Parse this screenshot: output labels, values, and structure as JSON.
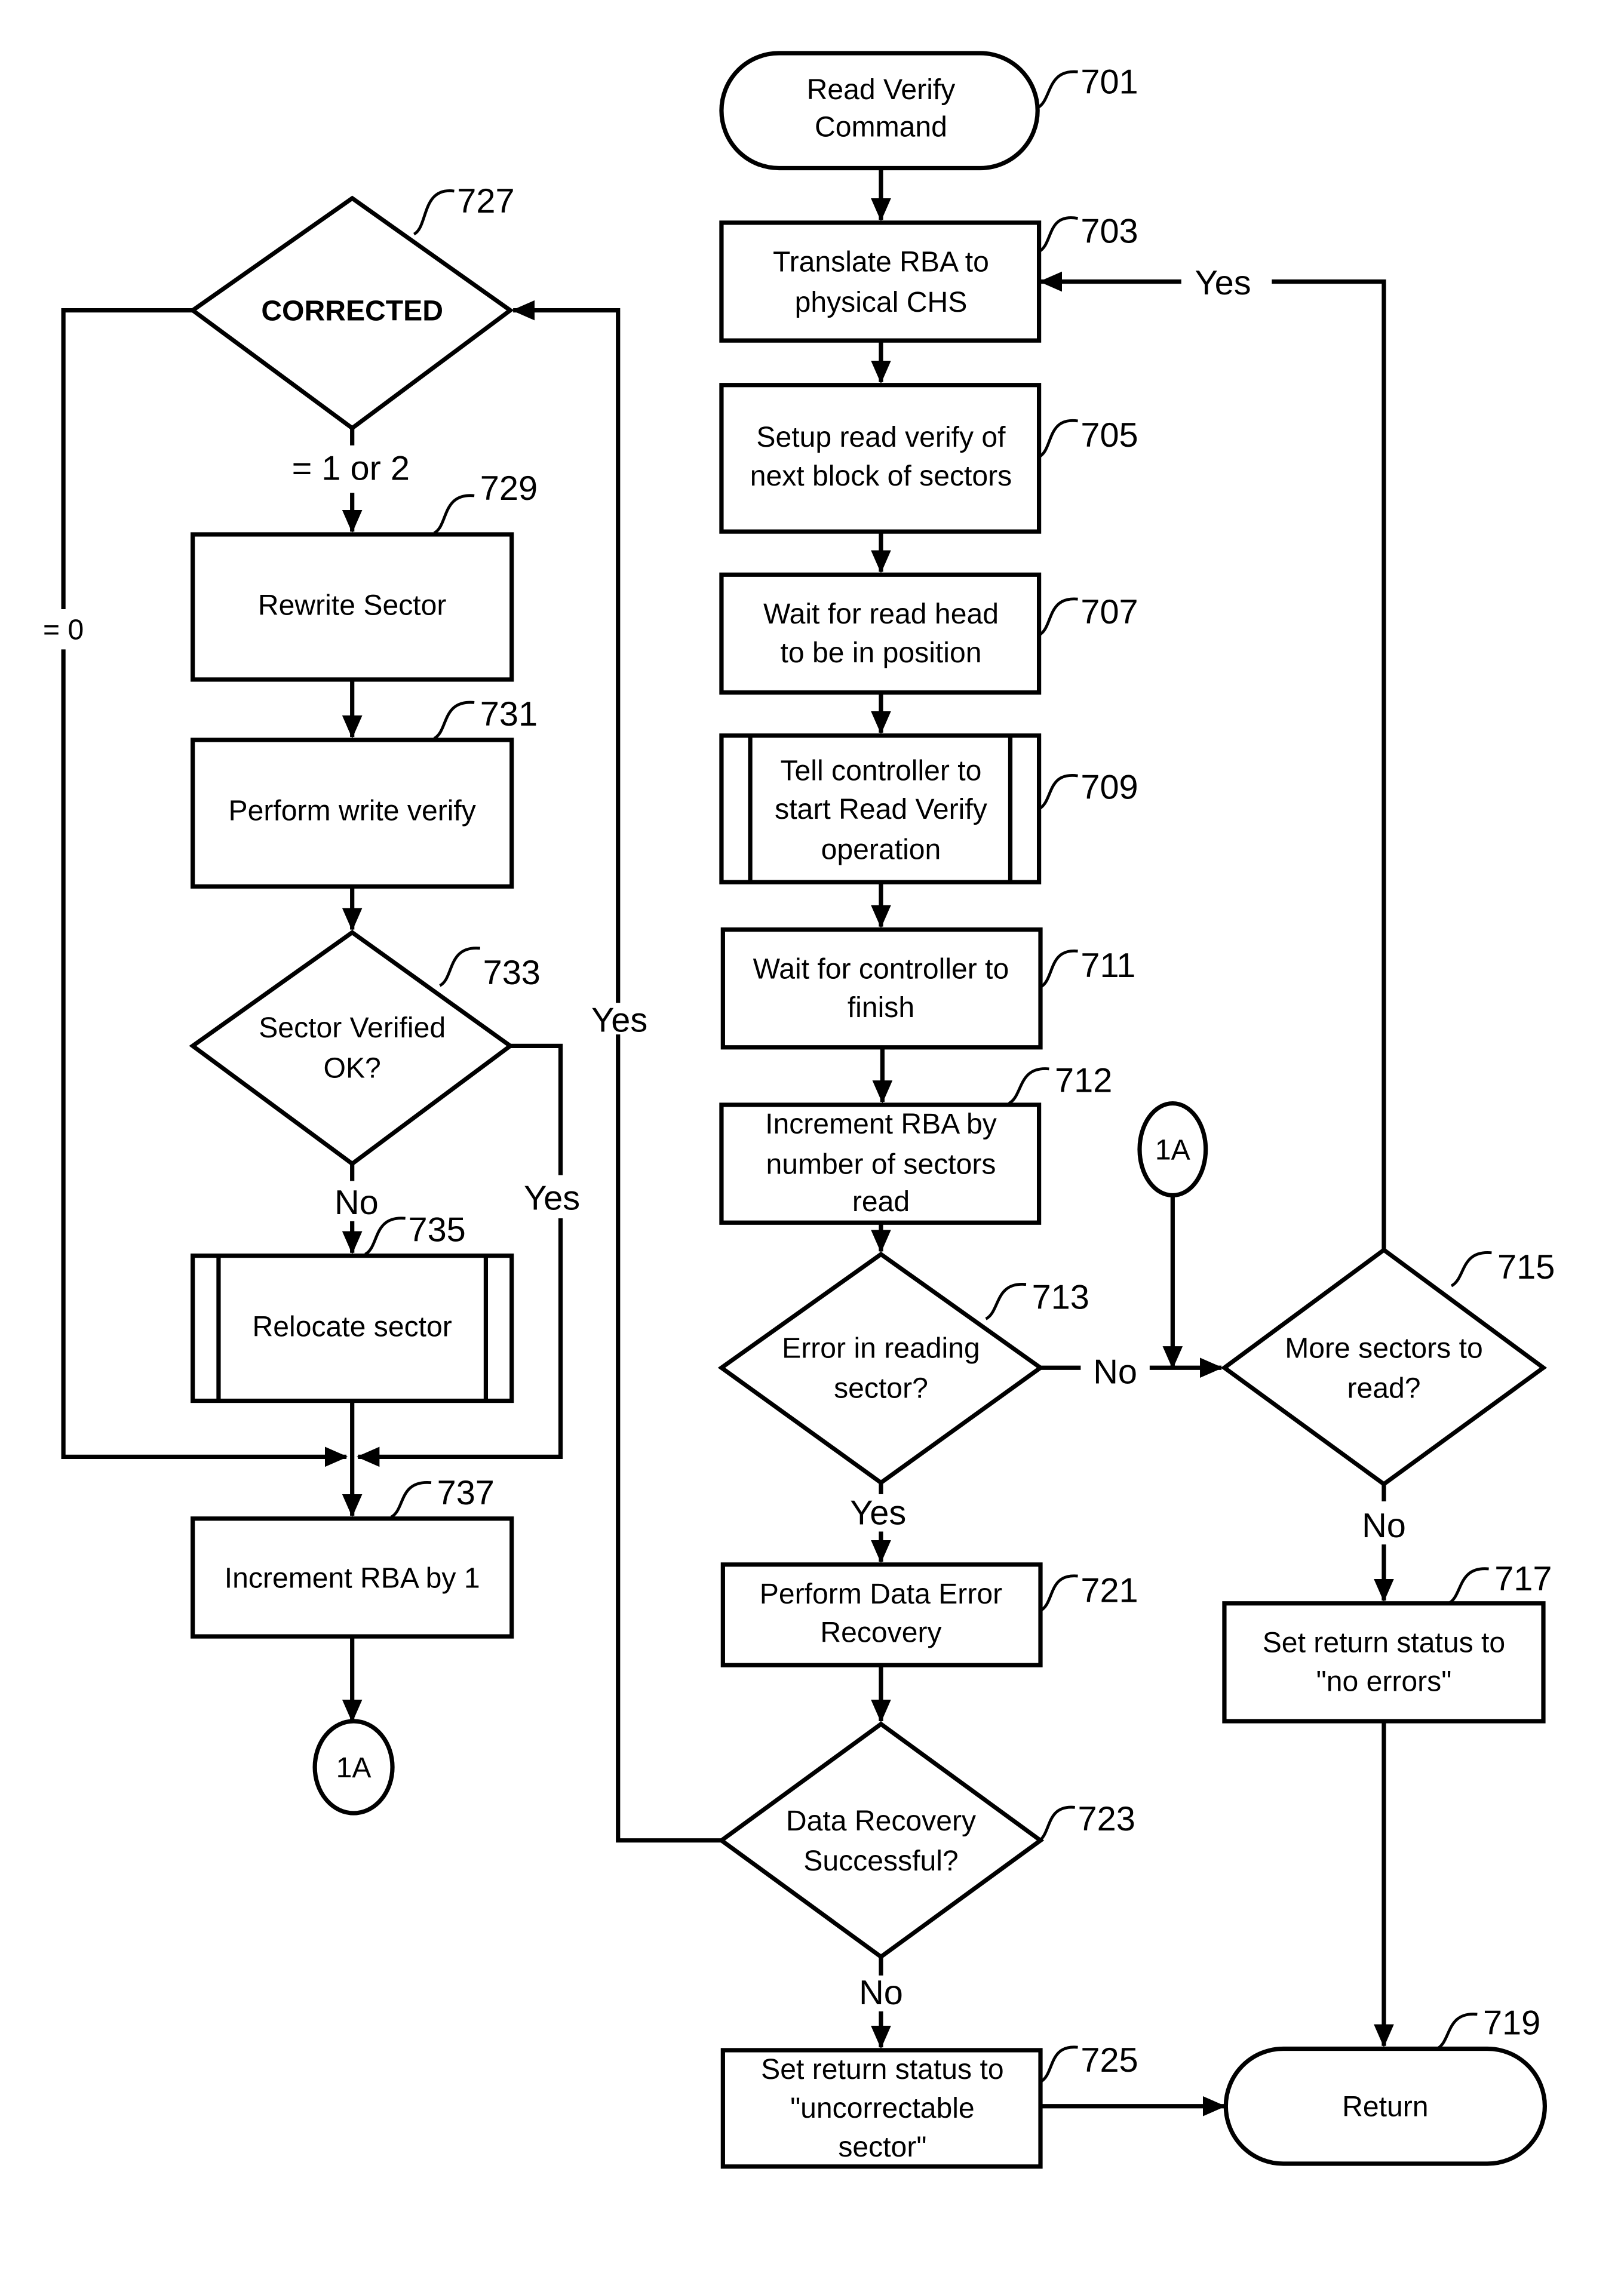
{
  "nodes": {
    "n701": {
      "ref": "701",
      "lines": [
        "Read Verify",
        "Command"
      ]
    },
    "n703": {
      "ref": "703",
      "lines": [
        "Translate RBA to",
        "physical CHS"
      ]
    },
    "n705": {
      "ref": "705",
      "lines": [
        "Setup read verify of",
        "next block of sectors"
      ]
    },
    "n707": {
      "ref": "707",
      "lines": [
        "Wait for read head",
        "to be in position"
      ]
    },
    "n709": {
      "ref": "709",
      "lines": [
        "Tell controller to",
        "start Read Verify",
        "operation"
      ]
    },
    "n711": {
      "ref": "711",
      "lines": [
        "Wait for controller to",
        "finish"
      ]
    },
    "n712": {
      "ref": "712",
      "lines": [
        "Increment RBA by",
        "number of sectors",
        "read"
      ]
    },
    "n713": {
      "ref": "713",
      "lines": [
        "Error in reading",
        "sector?"
      ]
    },
    "n715": {
      "ref": "715",
      "lines": [
        "More sectors to",
        "read?"
      ]
    },
    "n717": {
      "ref": "717",
      "lines": [
        "Set return status to",
        "\"no errors\""
      ]
    },
    "n719": {
      "ref": "719",
      "lines": [
        "Return"
      ]
    },
    "n721": {
      "ref": "721",
      "lines": [
        "Perform Data Error",
        "Recovery"
      ]
    },
    "n723": {
      "ref": "723",
      "lines": [
        "Data Recovery",
        "Successful?"
      ]
    },
    "n725": {
      "ref": "725",
      "lines": [
        "Set return status to",
        "\"uncorrectable",
        "sector\""
      ]
    },
    "n727": {
      "ref": "727",
      "lines": [
        "CORRECTED"
      ]
    },
    "n729": {
      "ref": "729",
      "lines": [
        "Rewrite Sector"
      ]
    },
    "n731": {
      "ref": "731",
      "lines": [
        "Perform write verify"
      ]
    },
    "n733": {
      "ref": "733",
      "lines": [
        "Sector Verified",
        "OK?"
      ]
    },
    "n735": {
      "ref": "735",
      "lines": [
        "Relocate sector"
      ]
    },
    "n737": {
      "ref": "737",
      "lines": [
        "Increment RBA by 1"
      ]
    }
  },
  "connectors": {
    "c1": "1A",
    "c2": "1A"
  },
  "edges": {
    "e715_yes": "Yes",
    "e713_no": "No",
    "e713_yes": "Yes",
    "e715_no": "No",
    "e723_no": "No",
    "e723_yes": "Yes",
    "e727_12": "= 1 or 2",
    "e727_0": "= 0",
    "e733_no": "No",
    "e733_yes": "Yes"
  }
}
